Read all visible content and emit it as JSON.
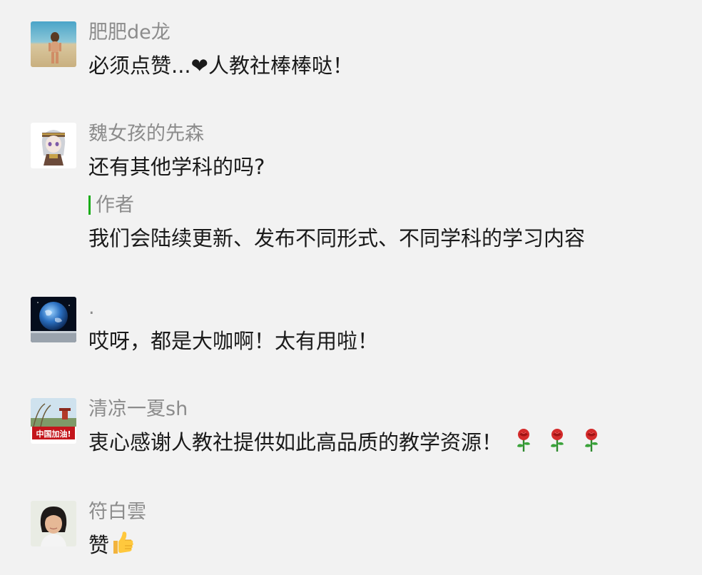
{
  "comments": [
    {
      "nickname": "肥肥de龙",
      "text": "必须点赞...❤人教社棒棒哒！",
      "avatar_icon": "child-on-beach-avatar"
    },
    {
      "nickname": "魏女孩的先森",
      "text": "还有其他学科的吗?",
      "avatar_icon": "anime-character-avatar",
      "reply": {
        "author_label": "作者",
        "text": "我们会陆续更新、发布不同形式、不同学科的学习内容"
      }
    },
    {
      "nickname": ".",
      "text": "哎呀，都是大咖啊！太有用啦！",
      "avatar_icon": "earth-from-space-avatar"
    },
    {
      "nickname": "清凉一夏sh",
      "text": "衷心感谢人教社提供如此高品质的教学资源！",
      "avatar_icon": "china-cheer-avatar",
      "avatar_text": "中国加油!",
      "emojis": [
        "rose-emoji",
        "rose-emoji",
        "rose-emoji"
      ]
    },
    {
      "nickname": "符白雲",
      "text": "赞",
      "avatar_icon": "woman-portrait-avatar",
      "emojis": [
        "thumbs-up-emoji"
      ]
    }
  ],
  "colors": {
    "background": "#f2f2f2",
    "nickname": "#8c8c8c",
    "text": "#1a1a1a",
    "author_bar": "#1aad19"
  }
}
